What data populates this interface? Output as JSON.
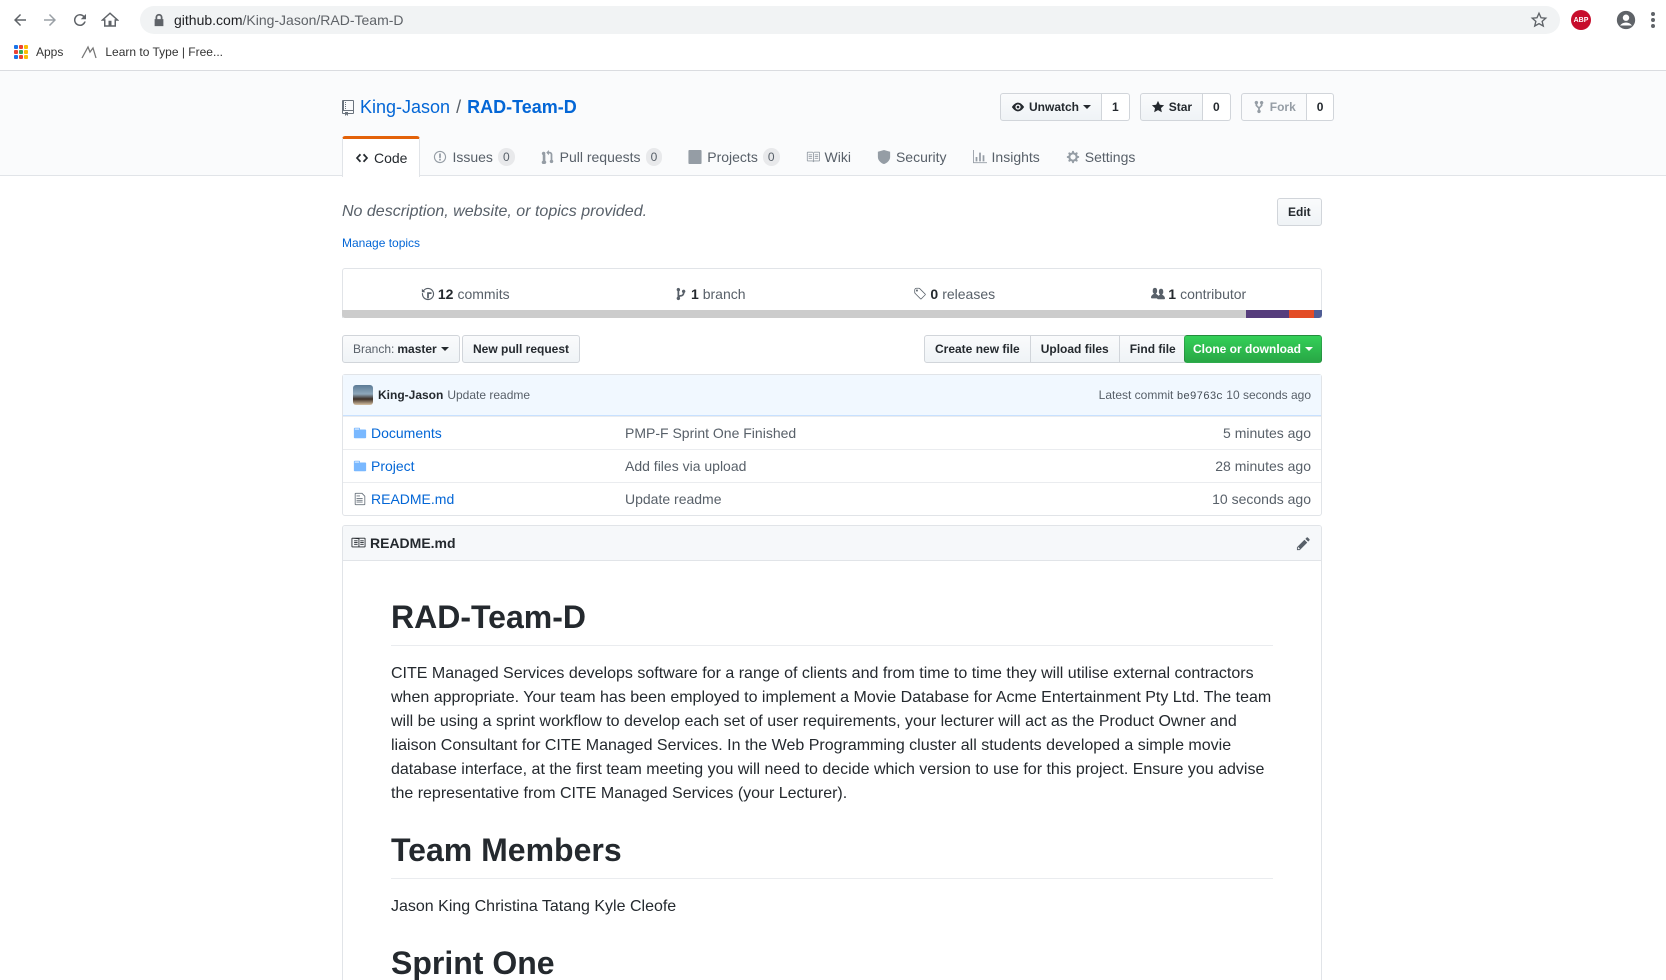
{
  "browser": {
    "url_host": "github.com",
    "url_path": "/King-Jason/RAD-Team-D",
    "abp_label": "ABP",
    "bookmarks": [
      {
        "label": "Apps",
        "icon": "apps-grid-icon"
      },
      {
        "label": "Learn to Type | Free...",
        "icon": "typing-icon"
      }
    ]
  },
  "repo": {
    "owner": "King-Jason",
    "separator": "/",
    "name": "RAD-Team-D",
    "actions": {
      "watch_label": "Unwatch",
      "watch_count": "1",
      "star_label": "Star",
      "star_count": "0",
      "fork_label": "Fork",
      "fork_count": "0"
    },
    "nav": [
      {
        "label": "Code",
        "icon": "code-icon",
        "selected": true
      },
      {
        "label": "Issues",
        "count": "0",
        "icon": "issue-icon"
      },
      {
        "label": "Pull requests",
        "count": "0",
        "icon": "pull-request-icon"
      },
      {
        "label": "Projects",
        "count": "0",
        "icon": "project-icon"
      },
      {
        "label": "Wiki",
        "icon": "book-icon"
      },
      {
        "label": "Security",
        "icon": "shield-icon"
      },
      {
        "label": "Insights",
        "icon": "graph-icon"
      },
      {
        "label": "Settings",
        "icon": "gear-icon"
      }
    ],
    "description": "No description, website, or topics provided.",
    "manage_topics": "Manage topics",
    "edit_label": "Edit"
  },
  "summary": {
    "commits_count": "12",
    "commits_label": "commits",
    "branch_count": "1",
    "branch_label": "branch",
    "releases_count": "0",
    "releases_label": "releases",
    "contributor_count": "1",
    "contributor_label": "contributor"
  },
  "language_bar": {
    "colors": [
      "#cccccc",
      "#563d7c",
      "#e34c26",
      "#4F5D95"
    ],
    "shares": [
      0.923,
      0.044,
      0.025,
      0.008
    ]
  },
  "file_nav": {
    "branch_prefix": "Branch:",
    "branch_name": "master",
    "new_pr": "New pull request",
    "create_file": "Create new file",
    "upload_files": "Upload files",
    "find_file": "Find file",
    "clone": "Clone or download"
  },
  "commit": {
    "author": "King-Jason",
    "message": "Update readme",
    "latest_label": "Latest commit",
    "sha": "be9763c",
    "age": "10 seconds ago"
  },
  "files": [
    {
      "type": "dir",
      "icon": "folder-icon",
      "name": "Documents",
      "message": "PMP-F Sprint One Finished",
      "age": "5 minutes ago"
    },
    {
      "type": "dir",
      "icon": "folder-icon",
      "name": "Project",
      "message": "Add files via upload",
      "age": "28 minutes ago"
    },
    {
      "type": "file",
      "icon": "file-icon",
      "name": "README.md",
      "message": "Update readme",
      "age": "10 seconds ago"
    }
  ],
  "readme": {
    "filename": "README.md",
    "title": "RAD-Team-D",
    "intro": "CITE Managed Services develops software for a range of clients and from time to time they will utilise external contractors when appropriate. Your team has been employed to implement a Movie Database for Acme Entertainment Pty Ltd. The team will be using a sprint workflow to develop each set of user requirements, your lecturer will act as the Product Owner and liaison Consultant for CITE Managed Services. In the Web Programming cluster all students developed a simple movie database interface, at the first team meeting you will need to decide which version to use for this project. Ensure you advise the representative from CITE Managed Services (your Lecturer).",
    "team_heading": "Team Members",
    "team_members": "Jason King Christina Tatang Kyle Cleofe",
    "sprint_heading": "Sprint One"
  }
}
